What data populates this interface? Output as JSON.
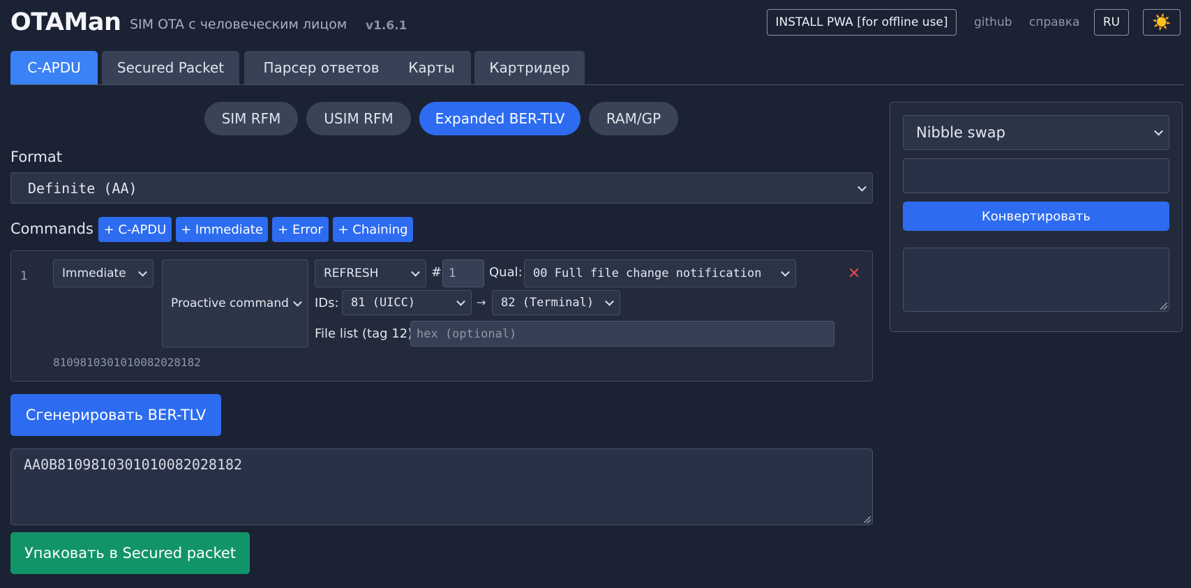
{
  "header": {
    "logo": "OTAMan",
    "tagline": "SIM OTA с человеческим лицом",
    "version": "v1.6.1",
    "install_pwa": "INSTALL PWA [for offline use]",
    "github": "github",
    "help": "справка",
    "lang": "RU",
    "theme_icon": "☀️"
  },
  "tabs": [
    {
      "label": "C-APDU",
      "active": true
    },
    {
      "label": "Secured Packet",
      "active": false
    },
    {
      "label": "Парсер ответов",
      "active": false
    },
    {
      "label": "Карты",
      "active": false
    },
    {
      "label": "Картридер",
      "active": false
    }
  ],
  "modes": [
    {
      "label": "SIM RFM",
      "active": false
    },
    {
      "label": "USIM RFM",
      "active": false
    },
    {
      "label": "Expanded BER-TLV",
      "active": true
    },
    {
      "label": "RAM/GP",
      "active": false
    }
  ],
  "format": {
    "label": "Format",
    "value": "Definite (AA)"
  },
  "commands": {
    "label": "Commands",
    "add_capdu": "+ C-APDU",
    "add_immediate": "+ Immediate",
    "add_error": "+ Error",
    "add_chaining": "+ Chaining"
  },
  "command_row": {
    "index": "1",
    "type": "Immediate",
    "kind": "Proactive command",
    "command": "REFRESH",
    "number_label": "#",
    "number": "1",
    "qual_label": "Qual:",
    "qual": "00 Full file change notification",
    "ids_label": "IDs:",
    "src_id": "81 (UICC)",
    "arrow": "→",
    "dst_id": "82 (Terminal)",
    "file_list_label": "File list (tag 12):",
    "file_list_placeholder": "hex (optional)",
    "hex_preview": "8109810301010082028182",
    "delete_icon": "✕"
  },
  "generate_button": "Сгенерировать BER-TLV",
  "output": "AA0B8109810301010082028182",
  "pack_button": "Упаковать в Secured packet",
  "converter": {
    "mode": "Nibble swap",
    "input": "",
    "convert_button": "Конвертировать",
    "output": ""
  },
  "colors": {
    "background": "#1b2233",
    "accent": "#2d6cf0",
    "success": "#12946a",
    "danger": "#e5484d"
  }
}
